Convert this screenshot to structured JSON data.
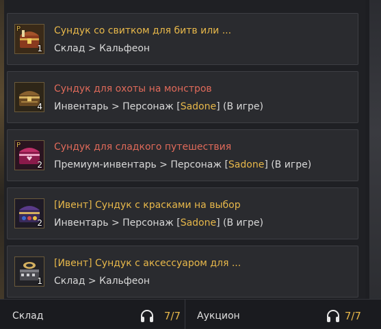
{
  "items": [
    {
      "title": "Сундук со свитком для битв или ...",
      "location": "Склад > Кальфеон",
      "count": "1",
      "badge": "P"
    },
    {
      "title": "Сундук для охоты на монстров",
      "location_prefix": "Инвентарь > Персонаж [",
      "character": "Sadone",
      "location_suffix": "] (В игре)",
      "count": "4"
    },
    {
      "title": "Сундук для сладкого путешествия",
      "location_prefix": "Премиум-инвентарь > Персонаж [",
      "character": "Sadone",
      "location_suffix": "] (В игре)",
      "count": "2",
      "badge": "P"
    },
    {
      "title": "[Ивент] Сундук с красками на выбор",
      "location_prefix": "Инвентарь > Персонаж [",
      "character": "Sadone",
      "location_suffix": "] (В игре)",
      "count": "2"
    },
    {
      "title": "[Ивент] Сундук с аксессуаром для ...",
      "location": "Склад > Кальфеон",
      "count": "1"
    }
  ],
  "footer": {
    "left_label": "Склад",
    "left_count": "7/7",
    "right_label": "Аукцион",
    "right_count": "7/7",
    "icon": "headphones-icon"
  },
  "colors": {
    "gold": "#e8b84a",
    "red": "#e06a5a",
    "text": "#d9d9d9",
    "scroll_thumb": "#b08a4a"
  }
}
